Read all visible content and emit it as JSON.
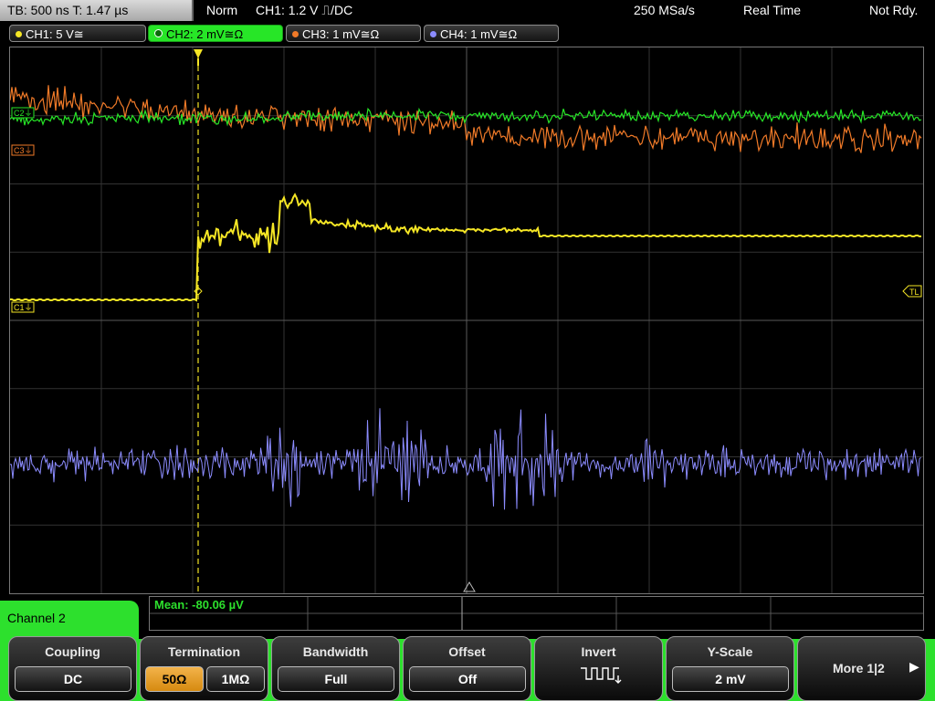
{
  "top": {
    "timebase": "TB: 500 ns   T: 1.47 µs",
    "mode": "Norm",
    "trigger": "CH1: 1.2 V ⎍/DC",
    "sample_rate": "250 MSa/s",
    "acq": "Real Time",
    "state": "Not Rdy."
  },
  "channels": [
    {
      "label": "CH1: 5 V≅",
      "color": "#f5e625"
    },
    {
      "label": "CH2: 2 mV≅Ω",
      "color": "#27e627"
    },
    {
      "label": "CH3: 1 mV≅Ω",
      "color": "#f07a28"
    },
    {
      "label": "CH4: 1 mV≅Ω",
      "color": "#8c8cff"
    }
  ],
  "markers": {
    "c1": "C1⏚",
    "c2": "C2⏚",
    "c3": "C3⏚",
    "tl": "TL"
  },
  "measurement": "Mean: -80.06 µV",
  "panel_title": "Channel 2",
  "softkeys": {
    "coupling": {
      "title": "Coupling",
      "value": "DC"
    },
    "termination": {
      "title": "Termination",
      "opt1": "50Ω",
      "opt2": "1MΩ"
    },
    "bandwidth": {
      "title": "Bandwidth",
      "value": "Full"
    },
    "offset": {
      "title": "Offset",
      "value": "Off"
    },
    "invert": {
      "title": "Invert",
      "icon": "pulse-invert-icon"
    },
    "yscale": {
      "title": "Y-Scale",
      "value": "2 mV"
    },
    "more": {
      "label": "More 1|2"
    }
  }
}
